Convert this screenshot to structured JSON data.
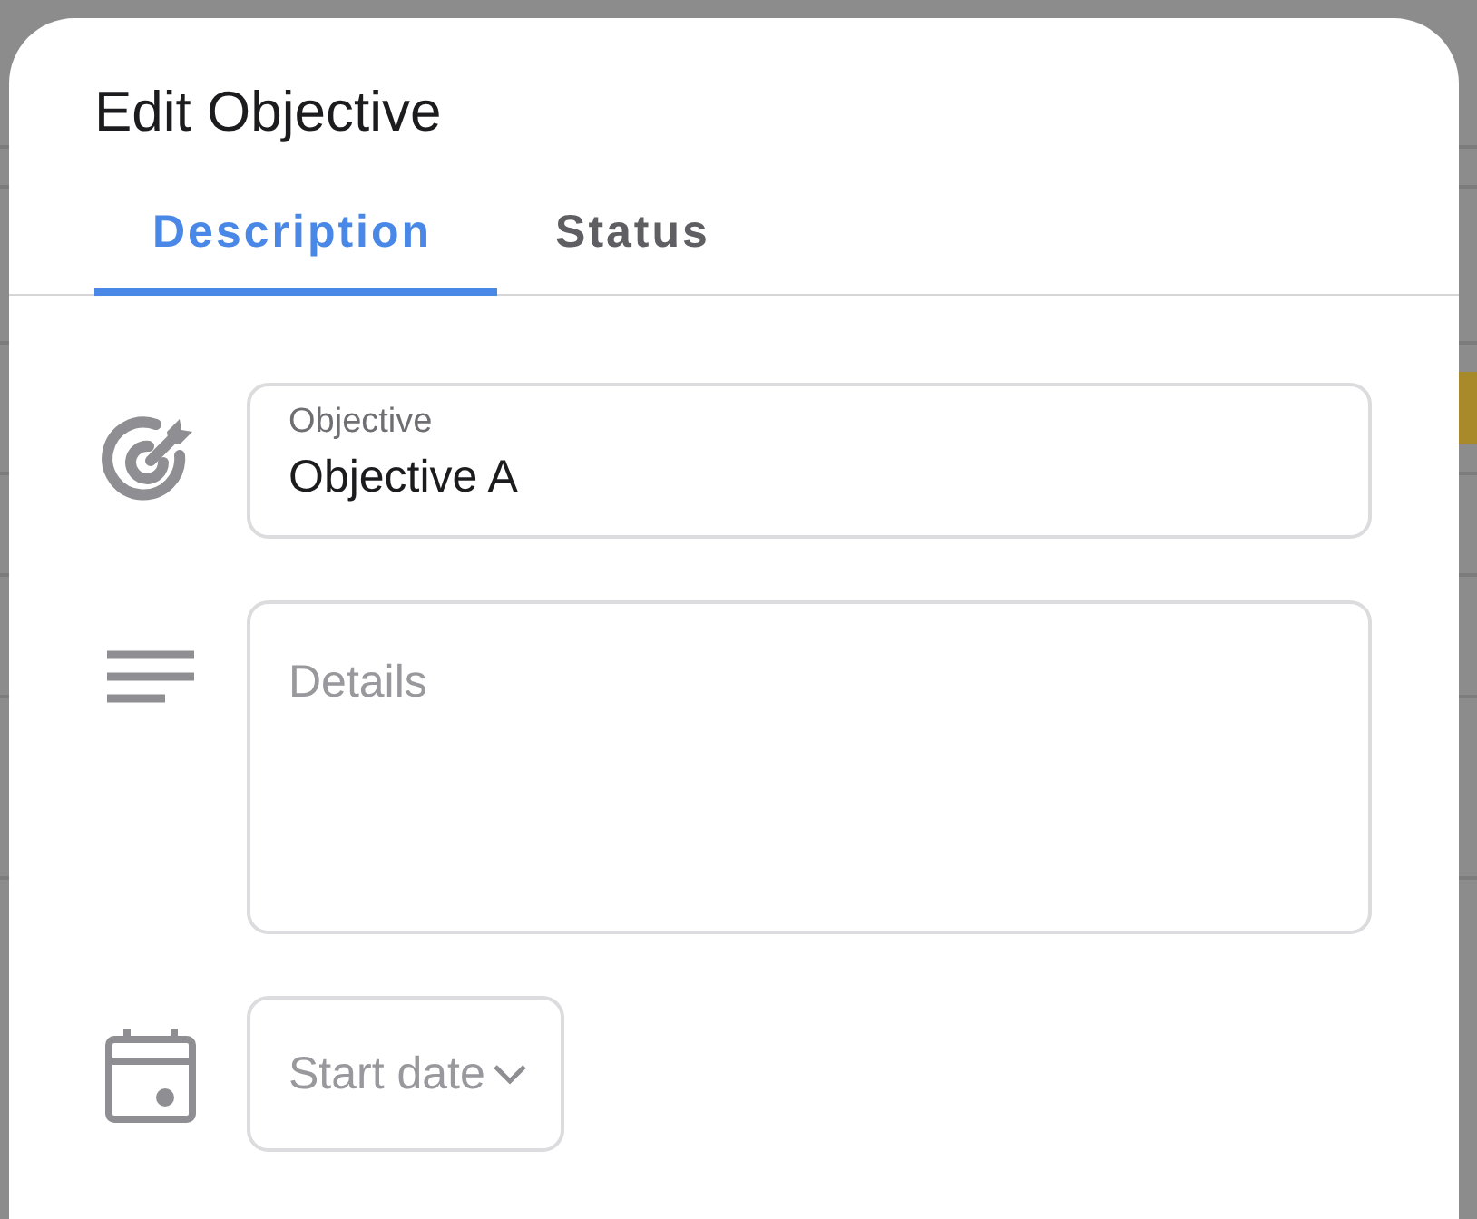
{
  "dialog": {
    "title": "Edit Objective"
  },
  "tabs": [
    {
      "label": "Description",
      "selected": true
    },
    {
      "label": "Status",
      "selected": false
    }
  ],
  "fields": [
    {
      "kind": "text",
      "label": "Objective",
      "value": "Objective A"
    },
    {
      "kind": "textarea",
      "placeholder": "Details"
    },
    {
      "kind": "select",
      "placeholder": "Start date"
    }
  ]
}
